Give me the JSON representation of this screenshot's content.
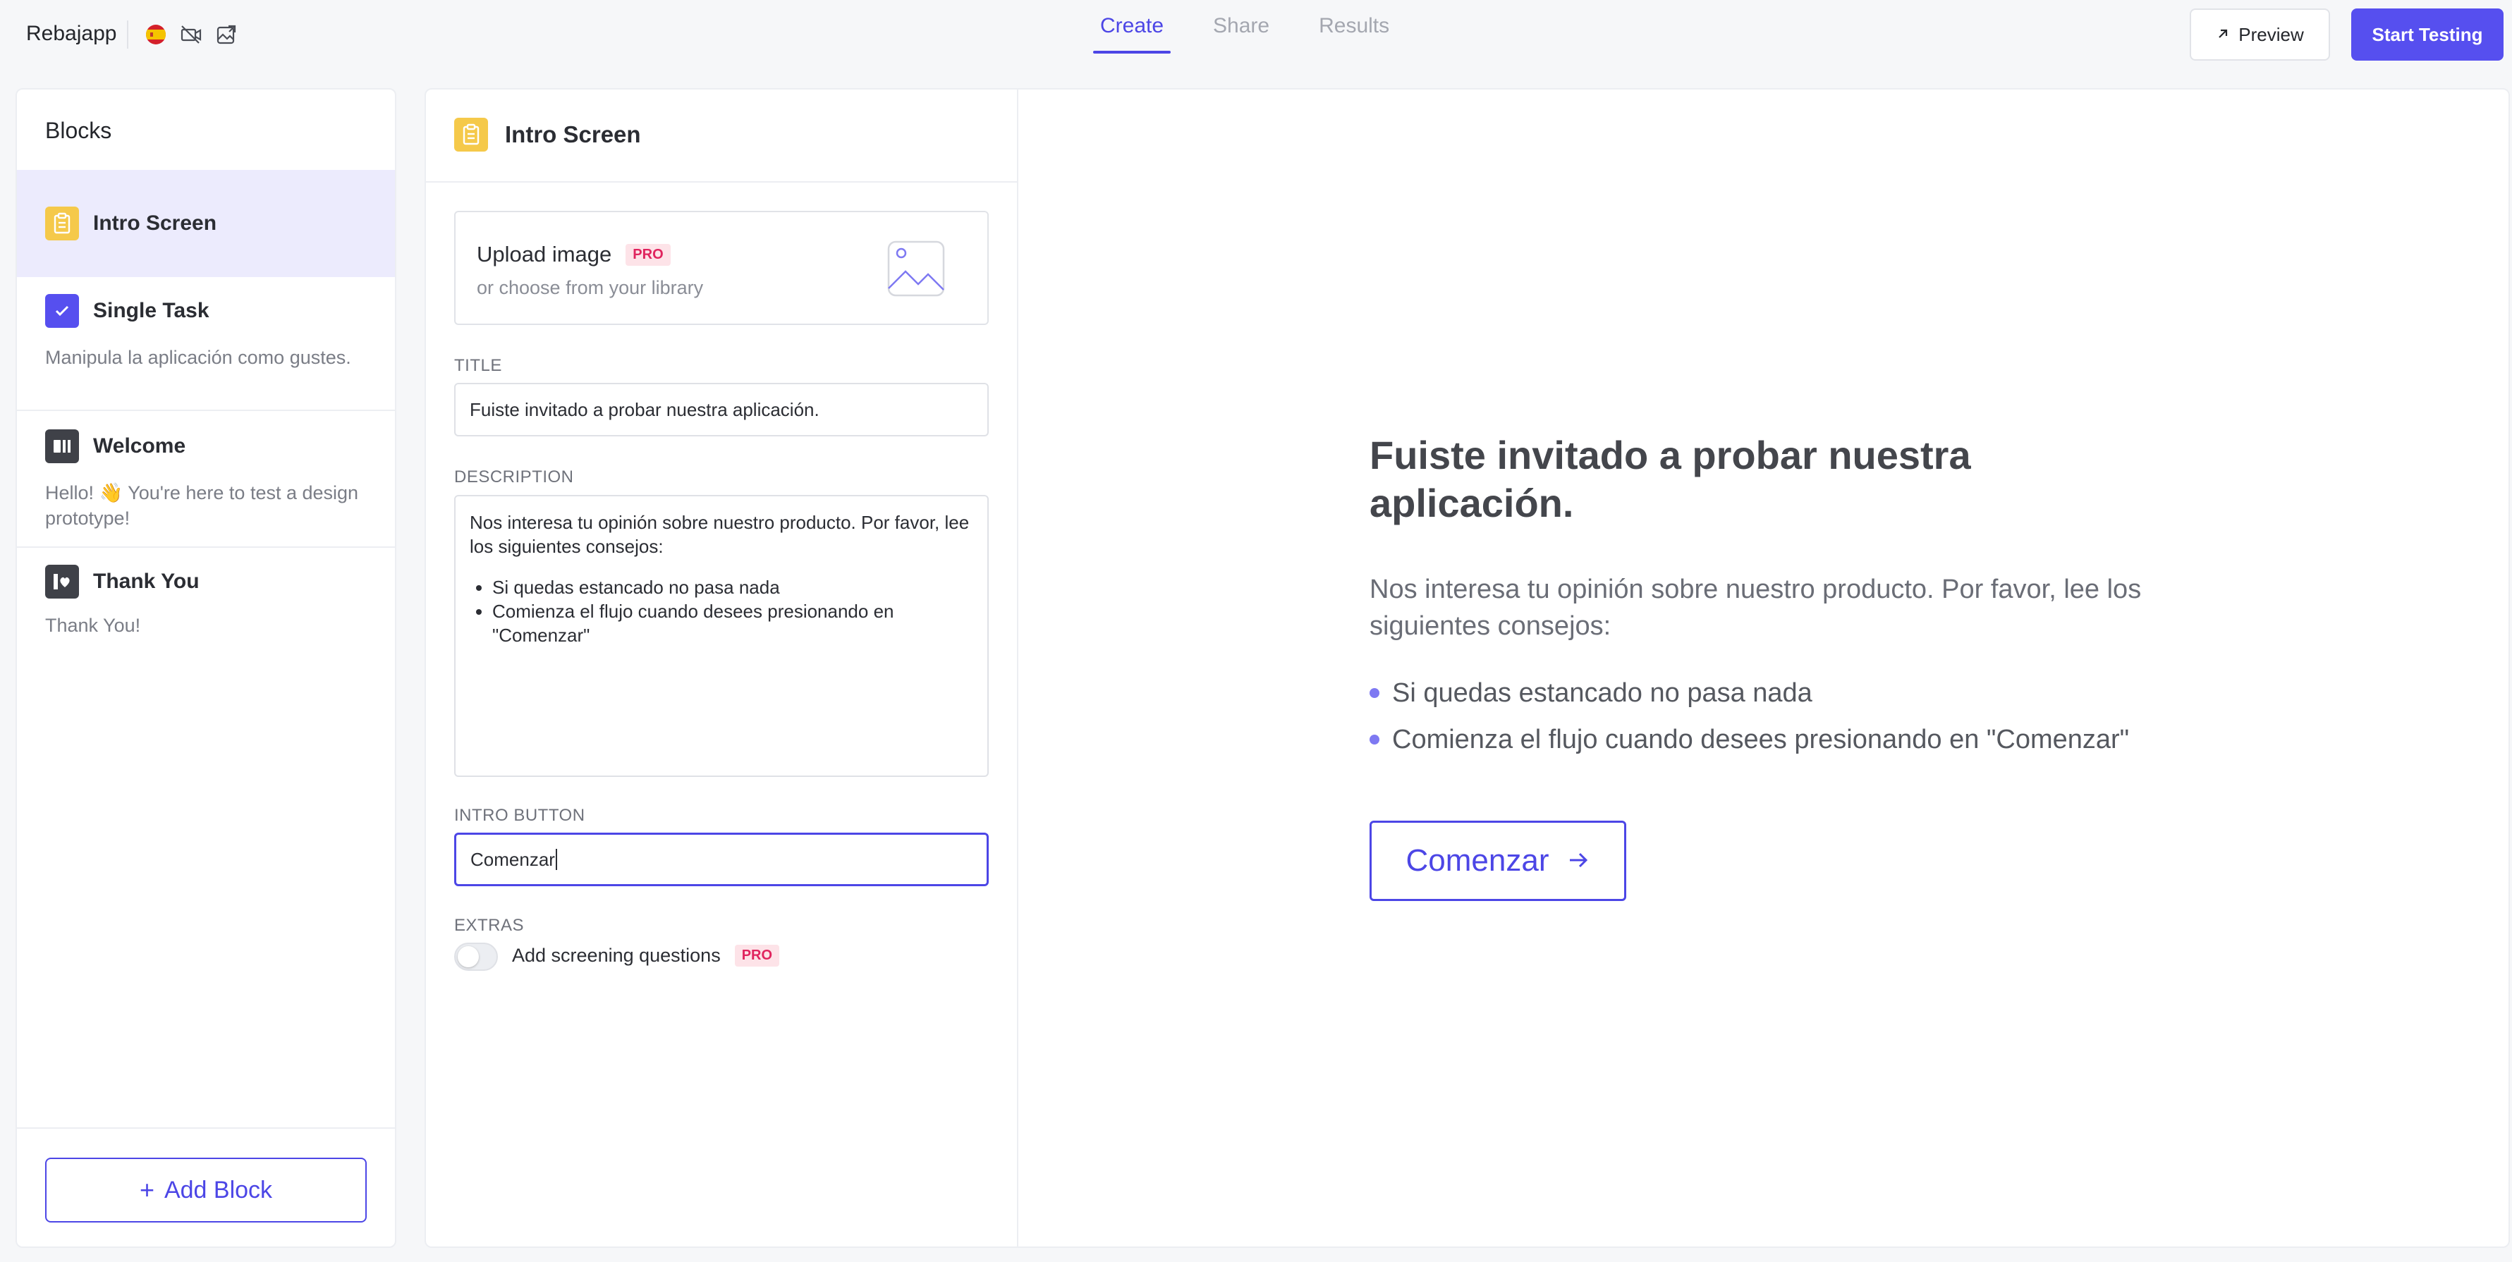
{
  "app": {
    "name": "Rebajapp"
  },
  "tabs": [
    {
      "label": "Create",
      "active": true
    },
    {
      "label": "Share",
      "active": false
    },
    {
      "label": "Results",
      "active": false
    }
  ],
  "actions": {
    "preview_label": "Preview",
    "start_label": "Start Testing"
  },
  "sidebar": {
    "title": "Blocks",
    "items": [
      {
        "label": "Intro Screen",
        "desc": "",
        "icon": "clipboard-icon",
        "active": true
      },
      {
        "label": "Single Task",
        "desc": "Manipula la aplicación como gustes.",
        "icon": "checkbox-icon"
      },
      {
        "label": "Welcome",
        "desc": "Hello! 👋 You're here to test a design prototype!",
        "icon": "welcome-icon"
      },
      {
        "label": "Thank You",
        "desc": "Thank You!",
        "icon": "heart-card-icon"
      }
    ],
    "add_block_label": "Add Block"
  },
  "editor": {
    "title": "Intro Screen",
    "upload": {
      "title": "Upload image",
      "badge": "PRO",
      "subtitle": "or choose from your library"
    },
    "title_label": "TITLE",
    "title_value": "Fuiste invitado a probar nuestra aplicación.",
    "description_label": "DESCRIPTION",
    "description_text": "Nos interesa tu opinión sobre nuestro producto. Por favor, lee los siguientes consejos:",
    "description_bullets": [
      "Si quedas estancado no pasa nada",
      "Comienza el flujo cuando desees presionando en \"Comenzar\""
    ],
    "intro_button_label": "INTRO BUTTON",
    "intro_button_value": "Comenzar",
    "extras_label": "EXTRAS",
    "screening_label": "Add screening questions",
    "screening_badge": "PRO"
  },
  "preview": {
    "title": "Fuiste invitado a probar nuestra aplicación.",
    "description": "Nos interesa tu opinión sobre nuestro producto. Por favor, lee los siguientes consejos:",
    "bullets": [
      "Si quedas estancado no pasa nada",
      "Comienza el flujo cuando desees presionando en \"Comenzar\""
    ],
    "button_label": "Comenzar"
  },
  "colors": {
    "accent": "#564fef",
    "intro_icon": "#f5c94a",
    "pro_badge": "#e0245e"
  }
}
